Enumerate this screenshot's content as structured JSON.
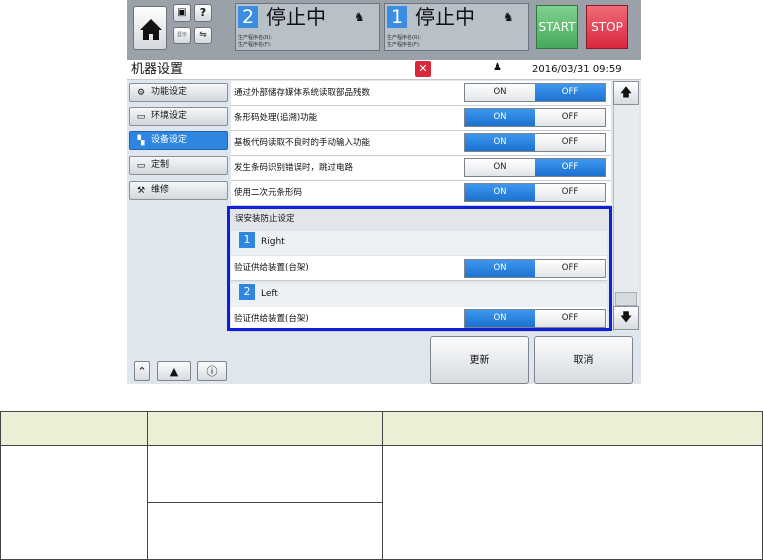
{
  "status": {
    "lane2": {
      "number": "2",
      "text": "停止中",
      "line1": "生产程序名(R):",
      "line2": "生产程序名(F):"
    },
    "lane1": {
      "number": "1",
      "text": "停止中",
      "line1": "生产程序名(R):",
      "line2": "生产程序名(F):"
    },
    "start_label": "START",
    "stop_label": "STOP",
    "small_btn_label": "显示"
  },
  "title": {
    "text": "机器设置",
    "datetime": "2016/03/31 09:59"
  },
  "sidebar": {
    "items": [
      {
        "label": "功能设定",
        "icon": "gear-icon"
      },
      {
        "label": "环境设定",
        "icon": "monitor-icon"
      },
      {
        "label": "设备设定",
        "icon": "machine-icon"
      },
      {
        "label": "定制",
        "icon": "monitor-gear-icon"
      },
      {
        "label": "维修",
        "icon": "maintenance-icon"
      }
    ]
  },
  "settings": {
    "on_label": "ON",
    "off_label": "OFF",
    "rows": [
      {
        "label": "通过外部储存媒体系统读取部品残数",
        "selected": "OFF"
      },
      {
        "label": "条形码处理(追溯)功能",
        "selected": "ON"
      },
      {
        "label": "基板代码读取不良时的手动输入功能",
        "selected": "ON"
      },
      {
        "label": "发生条码识别错误时，跳过电路",
        "selected": "OFF"
      },
      {
        "label": "使用二次元条形码",
        "selected": "ON"
      }
    ]
  },
  "group": {
    "title": "误安装防止设定",
    "lanes": [
      {
        "number": "1",
        "name": "Right",
        "row_label": "验证供给装置(台架)",
        "selected": "ON"
      },
      {
        "number": "2",
        "name": "Left",
        "row_label": "验证供给装置(台架)",
        "selected": "ON"
      }
    ]
  },
  "buttons": {
    "update": "更新",
    "cancel": "取消"
  },
  "colors": {
    "accent_blue": "#2f86e0",
    "highlight_frame": "#1020d8",
    "start_green": "#4fb864",
    "stop_red": "#e03246",
    "close_red": "#d9283a",
    "table_header": "#e9f0d6"
  }
}
